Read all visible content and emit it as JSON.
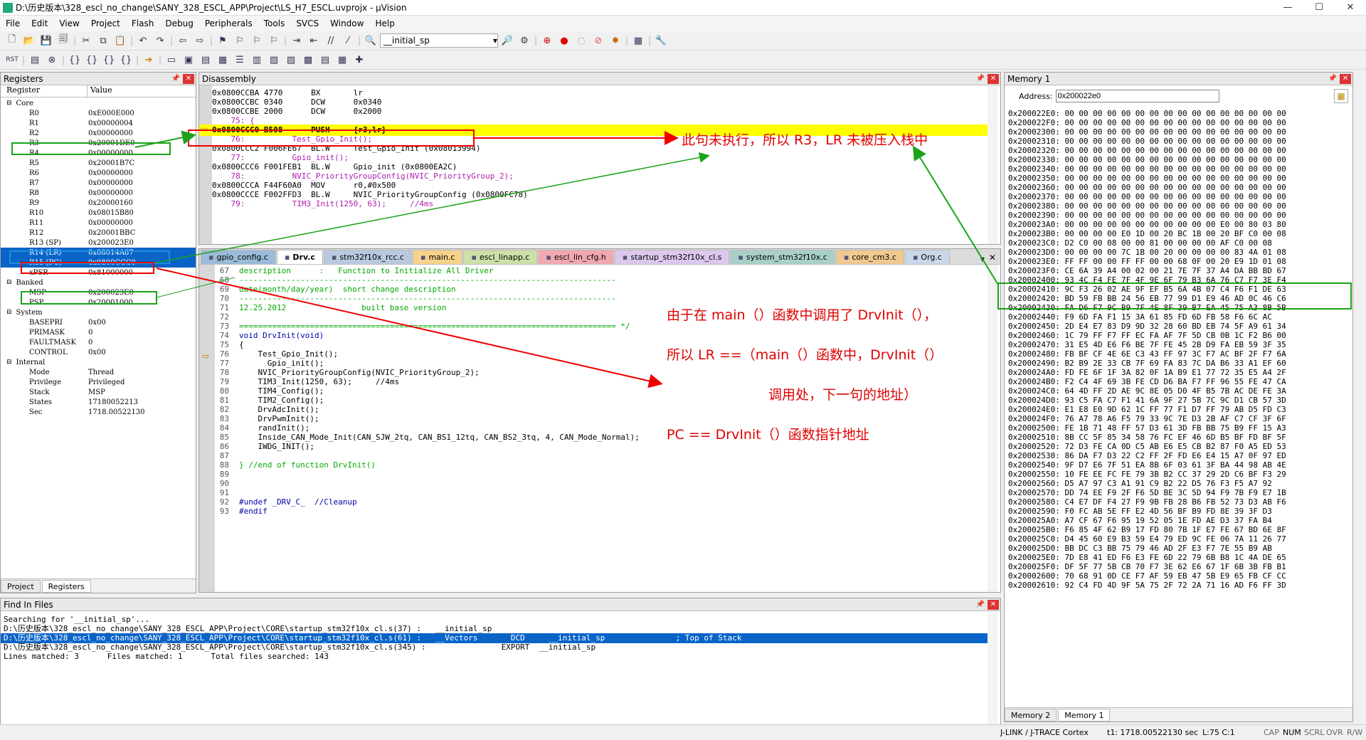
{
  "window": {
    "title": "D:\\历史版本\\328_escl_no_change\\SANY_328_ESCL_APP\\Project\\LS_H7_ESCL.uvprojx - µVision",
    "minimize": "—",
    "maximize": "☐",
    "close": "✕"
  },
  "menu": [
    "File",
    "Edit",
    "View",
    "Project",
    "Flash",
    "Debug",
    "Peripherals",
    "Tools",
    "SVCS",
    "Window",
    "Help"
  ],
  "toolbar": {
    "search_combo": "__initial_sp"
  },
  "registers": {
    "title": "Registers",
    "col_register": "Register",
    "col_value": "Value",
    "groups": {
      "core": "Core",
      "banked": "Banked",
      "system": "System",
      "internal": "Internal"
    },
    "core": [
      {
        "n": "R0",
        "v": "0xE000E000"
      },
      {
        "n": "R1",
        "v": "0x00000004"
      },
      {
        "n": "R2",
        "v": "0x00000000"
      },
      {
        "n": "R3",
        "v": "0x20001DE0"
      },
      {
        "n": "R4",
        "v": "0x00000000"
      },
      {
        "n": "R5",
        "v": "0x20001B7C"
      },
      {
        "n": "R6",
        "v": "0x00000000"
      },
      {
        "n": "R7",
        "v": "0x00000000"
      },
      {
        "n": "R8",
        "v": "0x00000000"
      },
      {
        "n": "R9",
        "v": "0x20000160"
      },
      {
        "n": "R10",
        "v": "0x08015B80"
      },
      {
        "n": "R11",
        "v": "0x00000000"
      },
      {
        "n": "R12",
        "v": "0x20001BBC"
      },
      {
        "n": "R13 (SP)",
        "v": "0x200023E0"
      },
      {
        "n": "R14 (LR)",
        "v": "0x08014A87"
      },
      {
        "n": "R15 (PC)",
        "v": "0x0800CCC0"
      },
      {
        "n": "xPSR",
        "v": "0x81000000"
      }
    ],
    "banked": [
      {
        "n": "MSP",
        "v": "0x200023E0"
      },
      {
        "n": "PSP",
        "v": "0x20001000"
      }
    ],
    "system": [
      {
        "n": "BASEPRI",
        "v": "0x00"
      },
      {
        "n": "PRIMASK",
        "v": "0"
      },
      {
        "n": "FAULTMASK",
        "v": "0"
      },
      {
        "n": "CONTROL",
        "v": "0x00"
      }
    ],
    "internal": [
      {
        "n": "Mode",
        "v": "Thread"
      },
      {
        "n": "Privilege",
        "v": "Privileged"
      },
      {
        "n": "Stack",
        "v": "MSP"
      },
      {
        "n": "States",
        "v": "17180052213"
      },
      {
        "n": "Sec",
        "v": "1718.00522130"
      }
    ],
    "tab_project": "Project",
    "tab_registers": "Registers"
  },
  "disassembly": {
    "title": "Disassembly",
    "lines": [
      "0x0800CCBA 4770      BX       lr",
      "0x0800CCBC 0340      DCW      0x0340",
      "0x0800CCBE 2000      DCW      0x2000",
      "    75: {",
      "0x0800CCC0 B508      PUSH     {r3,lr}",
      "    76:          Test_Gpio_Init();",
      "0x0800CCC2 F006FE67  BL.W     Test_Gpio_Init (0x08013994)",
      "    77:          Gpio_init();",
      "0x0800CCC6 F001FEB1  BL.W     Gpio_init (0x0800EA2C)",
      "    78:          NVIC_PriorityGroupConfig(NVIC_PriorityGroup_2);",
      "0x0800CCCA F44F60A0  MOV      r0,#0x500",
      "0x0800CCCE F002FFD3  BL.W     NVIC_PriorityGroupConfig (0x0800FC78)",
      "    79:          TIM3_Init(1250, 63);     //4ms"
    ]
  },
  "editor": {
    "tabs": [
      "gpio_config.c",
      "Drv.c",
      "stm32f10x_rcc.c",
      "main.c",
      "escl_linapp.c",
      "escl_lin_cfg.h",
      "startup_stm32f10x_cl.s",
      "system_stm32f10x.c",
      "core_cm3.c",
      "Org.c"
    ],
    "lines": [
      {
        "n": "67",
        "t": "description      :   Function to Initialize All Driver"
      },
      {
        "n": "68",
        "t": "--------------------------------------------------------------------------------"
      },
      {
        "n": "69",
        "t": "date(month/day/year)  short change description"
      },
      {
        "n": "70",
        "t": "--------------------------------------------------------------------------------"
      },
      {
        "n": "71",
        "t": "12.25.2012                built base version"
      },
      {
        "n": "72",
        "t": ""
      },
      {
        "n": "73",
        "t": "================================================================================ */"
      },
      {
        "n": "74",
        "t": "void DrvInit(void)"
      },
      {
        "n": "75",
        "t": "{"
      },
      {
        "n": "76",
        "t": "    Test_Gpio_Init();"
      },
      {
        "n": "77",
        "t": "      Gpio_init();"
      },
      {
        "n": "78",
        "t": "    NVIC_PriorityGroupConfig(NVIC_PriorityGroup_2);"
      },
      {
        "n": "79",
        "t": "    TIM3_Init(1250, 63);     //4ms"
      },
      {
        "n": "80",
        "t": "    TIM4_Config();"
      },
      {
        "n": "81",
        "t": "    TIM2_Config();"
      },
      {
        "n": "82",
        "t": "    DrvAdcInit();"
      },
      {
        "n": "83",
        "t": "    DrvPwmInit();"
      },
      {
        "n": "84",
        "t": "    randInit();"
      },
      {
        "n": "85",
        "t": "    Inside_CAN_Mode_Init(CAN_SJW_2tq, CAN_BS1_12tq, CAN_BS2_3tq, 4, CAN_Mode_Normal);"
      },
      {
        "n": "86",
        "t": "    IWDG_INIT();"
      },
      {
        "n": "87",
        "t": ""
      },
      {
        "n": "88",
        "t": "} //end of function DrvInit()"
      },
      {
        "n": "89",
        "t": ""
      },
      {
        "n": "90",
        "t": ""
      },
      {
        "n": "91",
        "t": ""
      },
      {
        "n": "92",
        "t": "#undef _DRV_C_  //Cleanup"
      },
      {
        "n": "93",
        "t": "#endif"
      }
    ]
  },
  "find": {
    "title": "Find In Files",
    "lines": [
      "Searching for '__initial_sp'...",
      "D:\\历史版本\\328_escl_no_change\\SANY_328_ESCL_APP\\Project\\CORE\\startup_stm32f10x_cl.s(37) :   __initial_sp",
      "D:\\历史版本\\328_escl_no_change\\SANY_328_ESCL_APP\\Project\\CORE\\startup_stm32f10x_cl.s(61) :   __Vectors       DCD     __initial_sp               ; Top of Stack",
      "D:\\历史版本\\328_escl_no_change\\SANY_328_ESCL_APP\\Project\\CORE\\startup_stm32f10x_cl.s(345) :                EXPORT  __initial_sp",
      "Lines matched: 3      Files matched: 1      Total files searched: 143"
    ]
  },
  "memory": {
    "title": "Memory 1",
    "address_label": "Address:",
    "address_value": "0x200022e0",
    "lines": [
      "0x200022E0: 00 00 00 00 00 00 00 00 00 00 00 00 00 00 00 00",
      "0x200022F0: 00 00 00 00 00 00 00 00 00 00 00 00 00 00 00 00",
      "0x20002300: 00 00 00 00 00 00 00 00 00 00 00 00 00 00 00 00",
      "0x20002310: 00 00 00 00 00 00 00 00 00 00 00 00 00 00 00 00",
      "0x20002320: 00 00 00 00 00 00 00 00 00 00 00 00 00 00 00 00",
      "0x20002330: 00 00 00 00 00 00 00 00 00 00 00 00 00 00 00 00",
      "0x20002340: 00 00 00 00 00 00 00 00 00 00 00 00 00 00 00 00",
      "0x20002350: 00 00 00 00 00 00 00 00 00 00 00 00 00 00 00 00",
      "0x20002360: 00 00 00 00 00 00 00 00 00 00 00 00 00 00 00 00",
      "0x20002370: 00 00 00 00 00 00 00 00 00 00 00 00 00 00 00 00",
      "0x20002380: 00 00 00 00 00 00 00 00 00 00 00 00 00 00 00 00",
      "0x20002390: 00 00 00 00 00 00 00 00 00 00 00 00 00 00 00 00",
      "0x200023A0: 00 00 00 00 00 00 00 00 00 00 00 E0 00 80 03 80",
      "0x200023B0: 00 00 00 00 E0 1D 00 20 BC 1B 00 20 BF C0 00 08",
      "0x200023C0: D2 C0 00 08 00 00 81 00 00 00 00 AF C0 00 08",
      "0x200023D0: 00 00 00 00 7C 1B 00 20 00 00 00 00 83 4A 01 08",
      "0x200023E0: FF FF 00 00 FF FF 00 00 68 0F 00 20 E9 1D 01 08",
      "0x200023F0: CE 6A 39 A4 00 02 00 21 7E 7F 37 A4 DA BB BD 67",
      "0x20002400: 93 4C F4 FE 7F 4F 9E 6F 79 B3 6A 76 C7 F7 3E F4",
      "0x20002410: 9C F3 26 02 AE 9F EF B5 6A 4B 07 C4 F6 F1 DE 63",
      "0x20002420: BD 59 FB BB 24 56 EB 77 99 D1 E9 46 AD 0C 46 C6",
      "0x20002430: FA D6 F7 9C B9 7F 4E 8F 39 B7 EA 45 75 A3 8B 5B",
      "0x20002440: F9 6D FA F1 15 3A 61 85 FD 6D FB 58 F6 6C AC",
      "0x20002450: 2D E4 E7 83 D9 9D 32 28 60 BD EB 74 5F A9 61 34",
      "0x20002460: 1C 79 FF F7 FF EC FA AF 7F 5D CB 0B 1C F2 B6 00",
      "0x20002470: 31 E5 4D E6 F6 BE 7F FE 45 2B D9 FA EB 59 3F 35",
      "0x20002480: FB BF CF 4E 6E C3 43 FF 97 3C F7 AC BF 2F F7 6A",
      "0x20002490: B2 B9 2E 33 CB 7F 69 FA 83 7C DA B6 33 A1 EF 60",
      "0x200024A0: FD FE 6F 1F 3A 82 0F 1A B9 E1 77 72 35 E5 A4 2F",
      "0x200024B0: F2 C4 4F 69 3B FE CD D6 BA F7 FF 96 55 FE 47 CA",
      "0x200024C0: 64 4D FF 2D AE 9C 8E 05 D0 4F B5 7B AC DE FE 3A",
      "0x200024D0: 93 C5 FA C7 F1 41 6A 9F 27 5B 7C 9C D1 CB 57 3D",
      "0x200024E0: E1 E8 E0 9D 62 1C FF 77 F1 D7 FF 79 AB D5 FD C3",
      "0x200024F0: 76 A7 78 A6 F5 79 33 9C 7E D3 2B AF C7 CF 3F 6F",
      "0x20002500: FE 1B 71 48 FF 57 D3 61 3D FB BB 75 B9 FF 15 A3",
      "0x20002510: 8B CC 5F 85 34 58 76 FC EF 46 6D B5 BF FD BF 5F",
      "0x20002520: 72 D3 FE CA 0D C5 AB E6 E5 CB B2 87 F0 A5 ED 53",
      "0x20002530: 86 DA F7 D3 22 C2 FF 2F FD E6 E4 15 A7 0F 97 ED",
      "0x20002540: 9F D7 E6 7F 51 EA 8B 6F 03 61 3F BA 44 98 AB 4E",
      "0x20002550: 10 FE EE FC FE 79 3B B2 CC 37 29 2D C6 BF F3 29",
      "0x20002560: D5 A7 97 C3 A1 91 C9 B2 22 D5 76 F3 F5 A7 92",
      "0x20002570: DD 74 EE F9 2F F6 5D BE 3C 5D 94 F9 7B F9 E7 1B",
      "0x20002580: C4 E7 DF F4 27 F9 9B FB 28 B6 FB 52 73 D3 AB F6",
      "0x20002590: F0 FC AB 5E FF E2 4D 56 BF B9 FD 8E 39 3F D3",
      "0x200025A0: A7 CF 67 F6 95 19 52 05 1E FD AE D3 37 FA B4",
      "0x200025B0: F6 85 4F 62 B9 17 FD 80 7B 1F E7 FE 67 BD 6E 8F",
      "0x200025C0: D4 45 60 E9 B3 59 E4 79 ED 9C FE 06 7A 11 26 77",
      "0x200025D0: BB DC C3 BB 75 79 46 AD 2F E3 F7 7E 55 B9 AB",
      "0x200025E0: 7D E8 41 ED F6 E3 FE 6D 22 79 6B B8 1C 4A DE 65",
      "0x200025F0: DF 5F 77 5B CB 70 F7 3E 62 E6 67 1F 6B 3B FB B1",
      "0x20002600: 70 68 91 0D CE F7 AF 59 EB 47 5B E9 65 FB CF CC",
      "0x20002610: 92 C4 FD 4D 9F 5A 75 2F 72 2A 71 16 AD F6 FF 3D"
    ],
    "tab_memory2": "Memory 2",
    "tab_memory1": "Memory 1"
  },
  "status": {
    "debugger": "J-LINK / J-TRACE Cortex",
    "time": "t1: 1718.00522130 sec",
    "position": "L:75 C:1",
    "cap": "CAP",
    "num": "NUM",
    "scrl": "SCRL",
    "ovr": "OVR",
    "rw": "R/W"
  },
  "annotations": {
    "a1": "此句未执行，所以 R3，LR 未被压入栈中",
    "a2": "由于在 main（）函数中调用了 DrvInit（），",
    "a3": "所以  LR  ==（main（）函数中，DrvInit（）",
    "a4": "调用处，下一句的地址）",
    "a5": "PC == DrvInit（）函数指针地址"
  }
}
